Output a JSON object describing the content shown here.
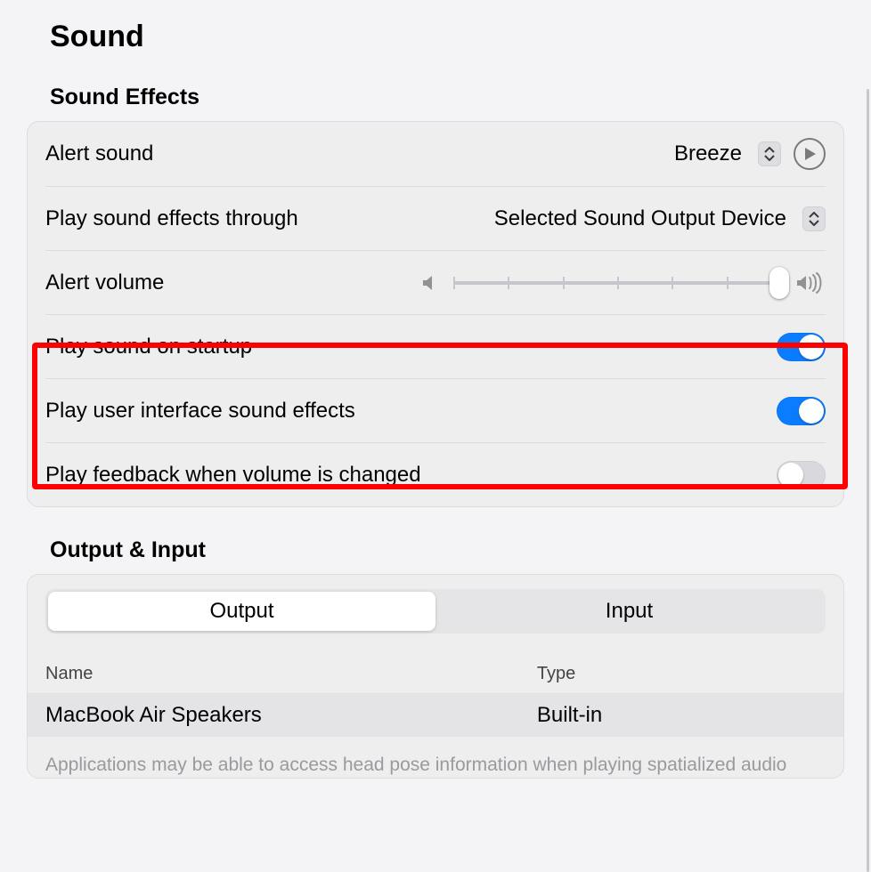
{
  "title": "Sound",
  "sections": {
    "sound_effects": {
      "heading": "Sound Effects",
      "alert_sound": {
        "label": "Alert sound",
        "value": "Breeze"
      },
      "play_through": {
        "label": "Play sound effects through",
        "value": "Selected Sound Output Device"
      },
      "alert_volume": {
        "label": "Alert volume"
      },
      "startup": {
        "label": "Play sound on startup",
        "on": true
      },
      "ui_effects": {
        "label": "Play user interface sound effects",
        "on": true
      },
      "feedback": {
        "label": "Play feedback when volume is changed",
        "on": false
      }
    },
    "output_input": {
      "heading": "Output & Input",
      "tabs": {
        "output": "Output",
        "input": "Input",
        "active": "output"
      },
      "columns": {
        "name": "Name",
        "type": "Type"
      },
      "rows": [
        {
          "name": "MacBook Air Speakers",
          "type": "Built-in"
        }
      ],
      "footnote": "Applications may be able to access head pose information when playing spatialized audio"
    }
  }
}
